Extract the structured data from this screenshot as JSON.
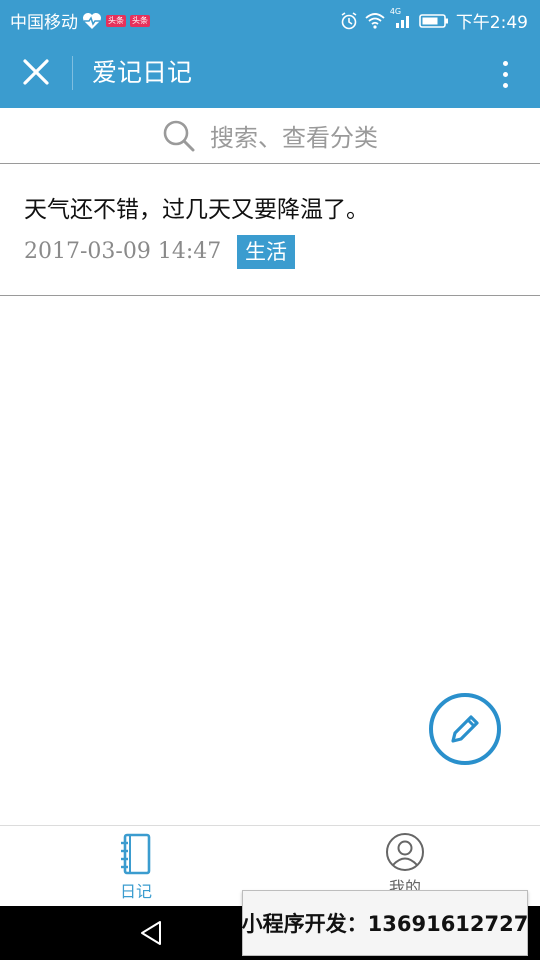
{
  "status_bar": {
    "carrier": "中国移动",
    "badges": [
      "头条",
      "头条"
    ],
    "network": "4G",
    "time": "下午2:49",
    "icons": [
      "heart-pulse-icon",
      "alarm-icon",
      "wifi-icon",
      "signal-icon",
      "battery-icon"
    ]
  },
  "titlebar": {
    "title": "爱记日记",
    "icons": [
      "close-icon",
      "more-vertical-icon"
    ]
  },
  "search": {
    "placeholder": "搜索、查看分类",
    "icon": "search-icon"
  },
  "entries": [
    {
      "text": "天气还不错，过几天又要降温了。",
      "date": "2017-03-09 14:47",
      "tag": "生活"
    }
  ],
  "fab": {
    "icon": "pencil-icon"
  },
  "tabbar": {
    "tabs": [
      {
        "label": "日记",
        "icon": "notebook-icon",
        "active": true
      },
      {
        "label": "我的",
        "icon": "user-icon",
        "active": false
      }
    ]
  },
  "navbar": {
    "icon": "back-triangle-icon"
  },
  "promo": {
    "text": "小程序开发：13691612727"
  },
  "colors": {
    "brand": "#3b9ccf",
    "fab_border": "#2a90cc",
    "tag_bg": "#3b9ccf",
    "muted_text": "#8a8a8a"
  }
}
